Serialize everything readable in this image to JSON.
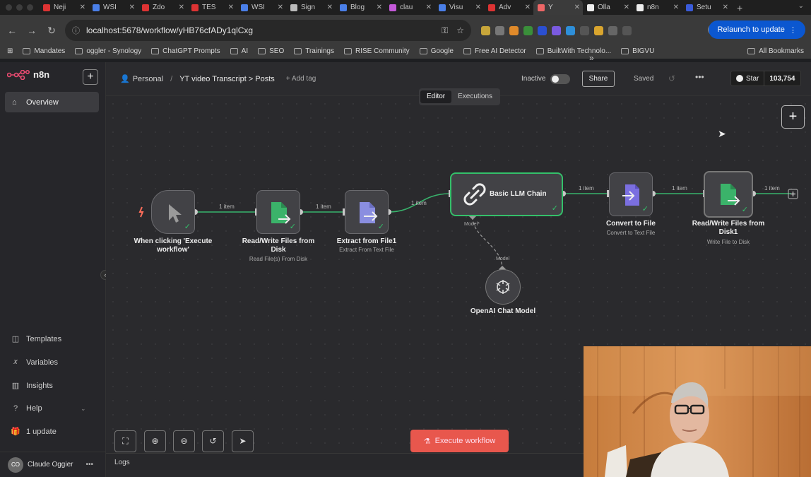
{
  "browser": {
    "tabs": [
      {
        "label": "Neji",
        "color": "#d33"
      },
      {
        "label": "WSI",
        "color": "#4a7fe8"
      },
      {
        "label": "Zdo",
        "color": "#d33"
      },
      {
        "label": "TES",
        "color": "#d33"
      },
      {
        "label": "WSI",
        "color": "#4a7fe8"
      },
      {
        "label": "Sign",
        "color": "#bbb"
      },
      {
        "label": "Blog",
        "color": "#4a7fe8"
      },
      {
        "label": "clau",
        "color": "#c459d9"
      },
      {
        "label": "Visu",
        "color": "#4a7fe8"
      },
      {
        "label": "Adv",
        "color": "#d33"
      },
      {
        "label": "Y",
        "color": "#e66"
      },
      {
        "label": "Olla",
        "color": "#eee"
      },
      {
        "label": "n8n",
        "color": "#eee"
      },
      {
        "label": "Setu",
        "color": "#3a5bd9"
      }
    ],
    "active_tab_index": 10,
    "url": "localhost:5678/workflow/yHB76cfADy1qlCxg",
    "relaunch_label": "Relaunch to update",
    "bookmarks": [
      "Mandates",
      "oggler - Synology",
      "ChatGPT Prompts",
      "AI",
      "SEO",
      "Trainings",
      "RISE Community",
      "Google",
      "Free AI Detector",
      "BuiltWith Technolo...",
      "BIGVU"
    ],
    "all_bookmarks_label": "All Bookmarks"
  },
  "sidebar": {
    "brand": "n8n",
    "overview_label": "Overview",
    "bottom_items": [
      {
        "label": "Templates",
        "icon": "templates-icon"
      },
      {
        "label": "Variables",
        "icon": "variables-icon"
      },
      {
        "label": "Insights",
        "icon": "insights-icon"
      },
      {
        "label": "Help",
        "icon": "help-icon"
      },
      {
        "label": "1 update",
        "icon": "gift-icon"
      }
    ],
    "user_initials": "CO",
    "user_name": "Claude Oggier"
  },
  "header": {
    "project": "Personal",
    "workflow_name": "YT video Transcript > Posts",
    "add_tag": "+ Add tag",
    "status_label": "Inactive",
    "share_label": "Share",
    "saved_label": "Saved",
    "star_label": "Star",
    "star_count": "103,754"
  },
  "canvas": {
    "tabs": [
      "Editor",
      "Executions"
    ],
    "active_tab": "Editor",
    "nodes": [
      {
        "id": "trigger",
        "name": "When clicking 'Execute workflow'",
        "sub": ""
      },
      {
        "id": "read1",
        "name": "Read/Write Files from Disk",
        "sub": "Read File(s) From Disk"
      },
      {
        "id": "extract",
        "name": "Extract from File1",
        "sub": "Extract From Text File"
      },
      {
        "id": "llm",
        "name": "Basic LLM Chain",
        "sub": ""
      },
      {
        "id": "convert",
        "name": "Convert to File",
        "sub": "Convert to Text File"
      },
      {
        "id": "write",
        "name": "Read/Write Files from Disk1",
        "sub": "Write File to Disk"
      },
      {
        "id": "openai",
        "name": "OpenAI Chat Model",
        "sub": ""
      }
    ],
    "edge_label": "1 item",
    "model_port_label": "Model*",
    "model_label": "Model",
    "execute_label": "Execute workflow",
    "logs_label": "Logs"
  }
}
